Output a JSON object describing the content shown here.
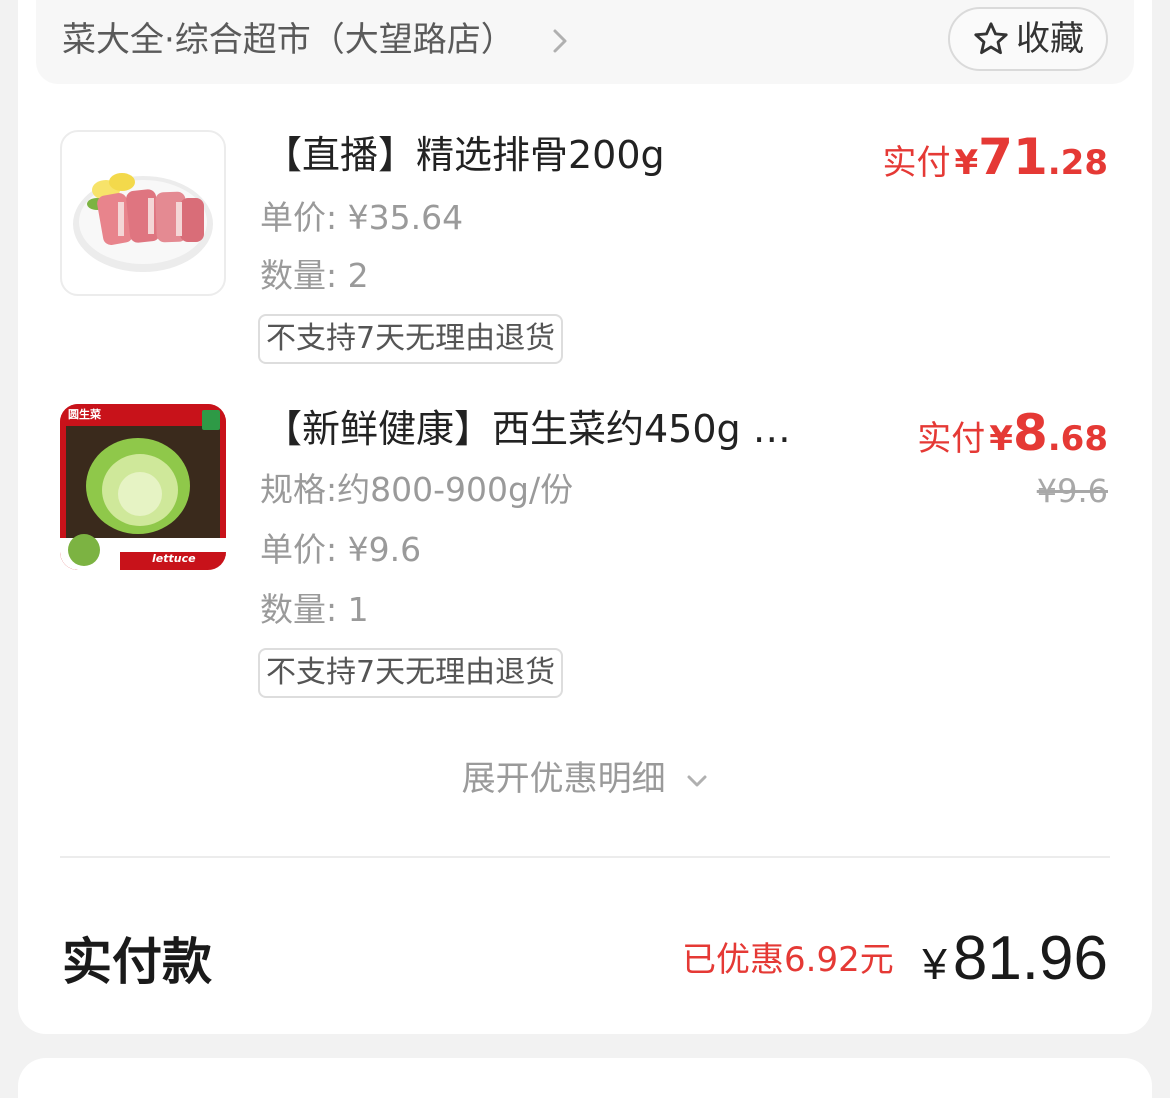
{
  "store": {
    "name": "菜大全·综合超市（大望路店）",
    "favorite_label": "收藏"
  },
  "items": [
    {
      "title": "【直播】精选排骨200g",
      "unit_price": "单价: ¥35.64",
      "quantity": "数量: 2",
      "tag": "不支持7天无理由退货",
      "paid_label": "实付",
      "paid_currency": "¥",
      "paid_int": "71",
      "paid_dec": ".28",
      "image_icon": "pork-ribs-image"
    },
    {
      "title": "【新鲜健康】西生菜约450g …",
      "spec": "规格:约800-900g/份",
      "unit_price": "单价: ¥9.6",
      "quantity": "数量: 1",
      "tag": "不支持7天无理由退货",
      "paid_label": "实付",
      "paid_currency": "¥",
      "paid_int": "8",
      "paid_dec": ".68",
      "original_price": "¥9.6",
      "image_icon": "lettuce-image",
      "image_text": {
        "top_badge": "圆生菜",
        "bottom": "lettuce"
      }
    }
  ],
  "expand_label": "展开优惠明细",
  "summary": {
    "label": "实付款",
    "discount": "已优惠6.92元",
    "currency": "¥",
    "amount": "81.96"
  },
  "colors": {
    "accent_red": "#e53935",
    "text_dark": "#222222",
    "text_muted": "#9a9a9a"
  }
}
